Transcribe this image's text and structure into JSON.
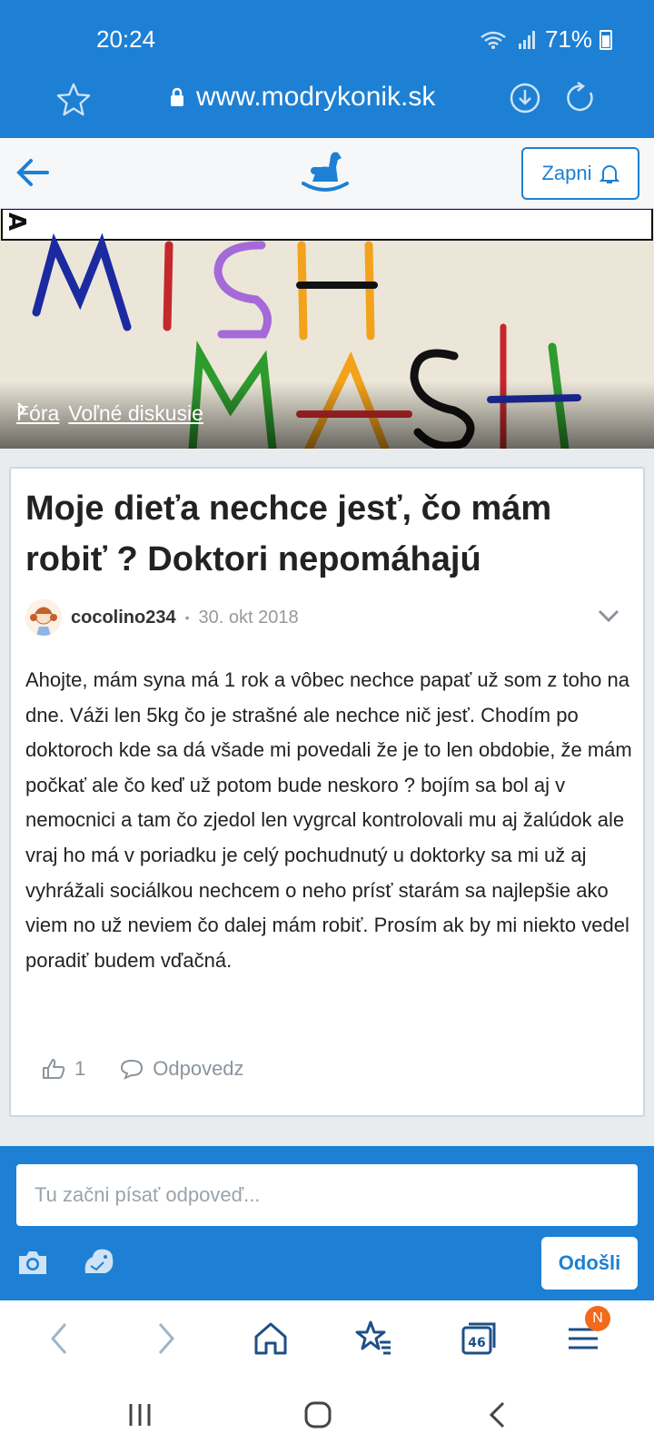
{
  "status": {
    "time": "20:24",
    "battery": "71%"
  },
  "browser": {
    "url": "www.modrykonik.sk",
    "tabs_count": "46",
    "menu_badge": "N"
  },
  "header": {
    "subscribe_label": "Zapni"
  },
  "banner": {
    "breadcrumb": [
      {
        "label": "Fóra"
      },
      {
        "label": "Voľné diskusie"
      }
    ]
  },
  "post": {
    "title": "Moje dieťa nechce jesť, čo mám robiť ? Doktori nepomáhajú",
    "author": "cocolino234",
    "date": "30. okt 2018",
    "body": "Ahojte, mám syna má 1 rok a vôbec nechce papať už som z toho na dne. Váži len 5kg čo je strašné ale nechce nič jesť. Chodím po doktoroch kde sa dá všade mi povedali že je to len obdobie, že mám počkať ale čo keď už potom bude neskoro ? bojím sa bol aj v nemocnici a tam čo zjedol len vygrcal kontrolovali mu aj žalúdok ale vraj ho má v poriadku je celý pochudnutý u doktorky sa mi už aj vyhrážali sociálkou nechcem o neho prísť starám sa najlepšie ako viem no už neviem čo dalej mám robiť. Prosím ak by mi niekto vedel poradiť budem vďačná.",
    "likes": "1",
    "reply_label": "Odpovedz"
  },
  "reply": {
    "placeholder": "Tu začni písať odpoveď...",
    "send_label": "Odošli"
  },
  "colors": {
    "brand": "#1d80d4",
    "badge": "#f26a1b"
  }
}
